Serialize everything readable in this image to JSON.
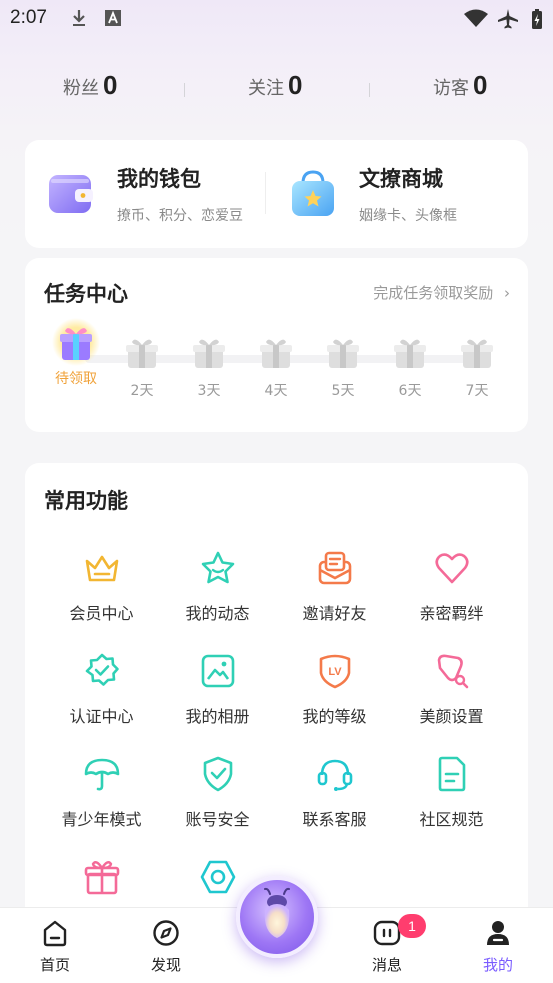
{
  "status_bar": {
    "time": "2:07"
  },
  "stats": [
    {
      "label": "粉丝",
      "value": "0"
    },
    {
      "label": "关注",
      "value": "0"
    },
    {
      "label": "访客",
      "value": "0"
    }
  ],
  "wallet": {
    "title": "我的钱包",
    "subtitle": "撩币、积分、恋爱豆"
  },
  "mall": {
    "title": "文撩商城",
    "subtitle": "姻缘卡、头像框"
  },
  "task_center": {
    "title": "任务中心",
    "link": "完成任务领取奖励",
    "days": [
      "待领取",
      "2天",
      "3天",
      "4天",
      "5天",
      "6天",
      "7天"
    ]
  },
  "functions": {
    "title": "常用功能",
    "items": [
      {
        "label": "会员中心",
        "icon": "crown-icon"
      },
      {
        "label": "我的动态",
        "icon": "star-icon"
      },
      {
        "label": "邀请好友",
        "icon": "envelope-icon"
      },
      {
        "label": "亲密羁绊",
        "icon": "heart-icon"
      },
      {
        "label": "认证中心",
        "icon": "verified-badge-icon"
      },
      {
        "label": "我的相册",
        "icon": "photo-icon"
      },
      {
        "label": "我的等级",
        "icon": "lv-shield-icon"
      },
      {
        "label": "美颜设置",
        "icon": "beauty-icon"
      },
      {
        "label": "青少年模式",
        "icon": "umbrella-icon"
      },
      {
        "label": "账号安全",
        "icon": "shield-check-icon"
      },
      {
        "label": "联系客服",
        "icon": "headset-icon"
      },
      {
        "label": "社区规范",
        "icon": "document-icon"
      },
      {
        "label": "",
        "icon": "gift-icon"
      },
      {
        "label": "",
        "icon": "settings-hexagon-icon"
      }
    ]
  },
  "bottom_nav": {
    "items": [
      "首页",
      "发现",
      "消息",
      "我的"
    ],
    "message_badge": "1",
    "active": "我的"
  },
  "colors": {
    "accent": "#7a5cff",
    "task_active": "#f0a23a",
    "badge": "#ff3d6e",
    "icon_yellow": "#f2b632",
    "icon_teal": "#2fd0b5",
    "icon_orange": "#f47a4a",
    "icon_pink": "#f46a98",
    "icon_cyan": "#1fc7cf"
  }
}
